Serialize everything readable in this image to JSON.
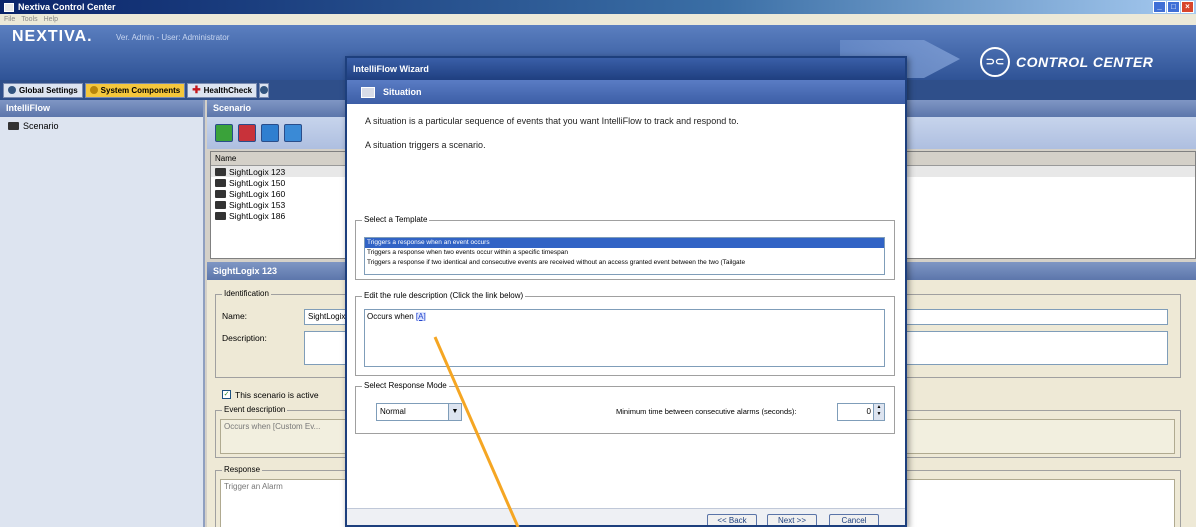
{
  "window": {
    "title": "Nextiva Control Center",
    "menu": [
      "File",
      "Tools",
      "Help"
    ]
  },
  "header": {
    "logo": "NEXTIVA.",
    "subtitle": "Ver. Admin - User: Administrator",
    "brand": "CONTROL CENTER",
    "brand_icon": "connector-icon"
  },
  "tabs": [
    {
      "label": "Global Settings",
      "active": false
    },
    {
      "label": "System Components",
      "active": true
    },
    {
      "label": "HealthCheck",
      "active": false
    }
  ],
  "left_panel": {
    "title": "IntelliFlow",
    "items": [
      "Scenario"
    ]
  },
  "scenario_panel": {
    "title": "Scenario",
    "list_header": "Name",
    "rows": [
      "SightLogix 123",
      "SightLogix 150",
      "SightLogix 160",
      "SightLogix 153",
      "SightLogix 186"
    ],
    "detail_title": "SightLogix 123",
    "identification_legend": "Identification",
    "name_label": "Name:",
    "name_value": "SightLogix 123",
    "description_label": "Description:",
    "active_label": "This scenario is active",
    "event_desc_legend": "Event description",
    "event_desc_value": "Occurs when [Custom Ev...",
    "response_legend": "Response",
    "response_value": "Trigger an Alarm"
  },
  "dialog": {
    "title": "IntelliFlow Wizard",
    "banner": "Situation",
    "intro_1": "A situation is a particular sequence of events that you want IntelliFlow to track and respond to.",
    "intro_2": "A situation triggers a scenario.",
    "template_legend": "Select a Template",
    "templates": [
      "Triggers a response when an event occurs",
      "Triggers a response when two events occur within a specific timespan",
      "Triggers a response if two identical and consecutive events are received without an access granted event between the two (Tailgate"
    ],
    "rule_legend": "Edit the rule description (Click the link below)",
    "rule_text": "Occurs when ",
    "rule_link": "[A]",
    "response_legend": "Select Response Mode",
    "response_mode": "Normal",
    "min_time_label": "Minimum time between consecutive alarms (seconds):",
    "min_time_value": "0",
    "back_label": "<< Back",
    "next_label": "Next >>",
    "cancel_label": "Cancel"
  },
  "colors": {
    "annotation": "#f5a623",
    "accent": "#1d3f7d",
    "active_tab": "#f5c73c"
  }
}
